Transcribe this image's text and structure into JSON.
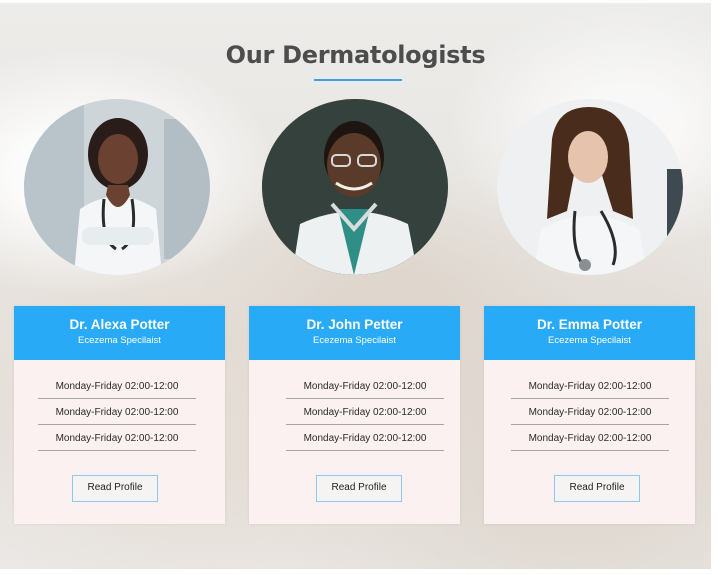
{
  "section": {
    "title": "Our Dermatologists"
  },
  "doctors": [
    {
      "name": "Dr. Alexa Potter",
      "specialty": "Ecezema Specilaist",
      "hours": [
        "Monday-Friday 02:00-12:00",
        "Monday-Friday 02:00-12:00",
        "Monday-Friday 02:00-12:00"
      ],
      "button_label": "Read Profile"
    },
    {
      "name": "Dr. John Petter",
      "specialty": "Ecezema Specilaist",
      "hours": [
        "Monday-Friday 02:00-12:00",
        "Monday-Friday 02:00-12:00",
        "Monday-Friday 02:00-12:00"
      ],
      "button_label": "Read Profile"
    },
    {
      "name": "Dr. Emma Potter",
      "specialty": "Ecezema Specilaist",
      "hours": [
        "Monday-Friday 02:00-12:00",
        "Monday-Friday 02:00-12:00",
        "Monday-Friday 02:00-12:00"
      ],
      "button_label": "Read Profile"
    }
  ],
  "colors": {
    "accent": "#29aaf7",
    "underline": "#3aa2e4",
    "card_body": "#fbf1f0",
    "title_text": "#4d4d4d"
  }
}
